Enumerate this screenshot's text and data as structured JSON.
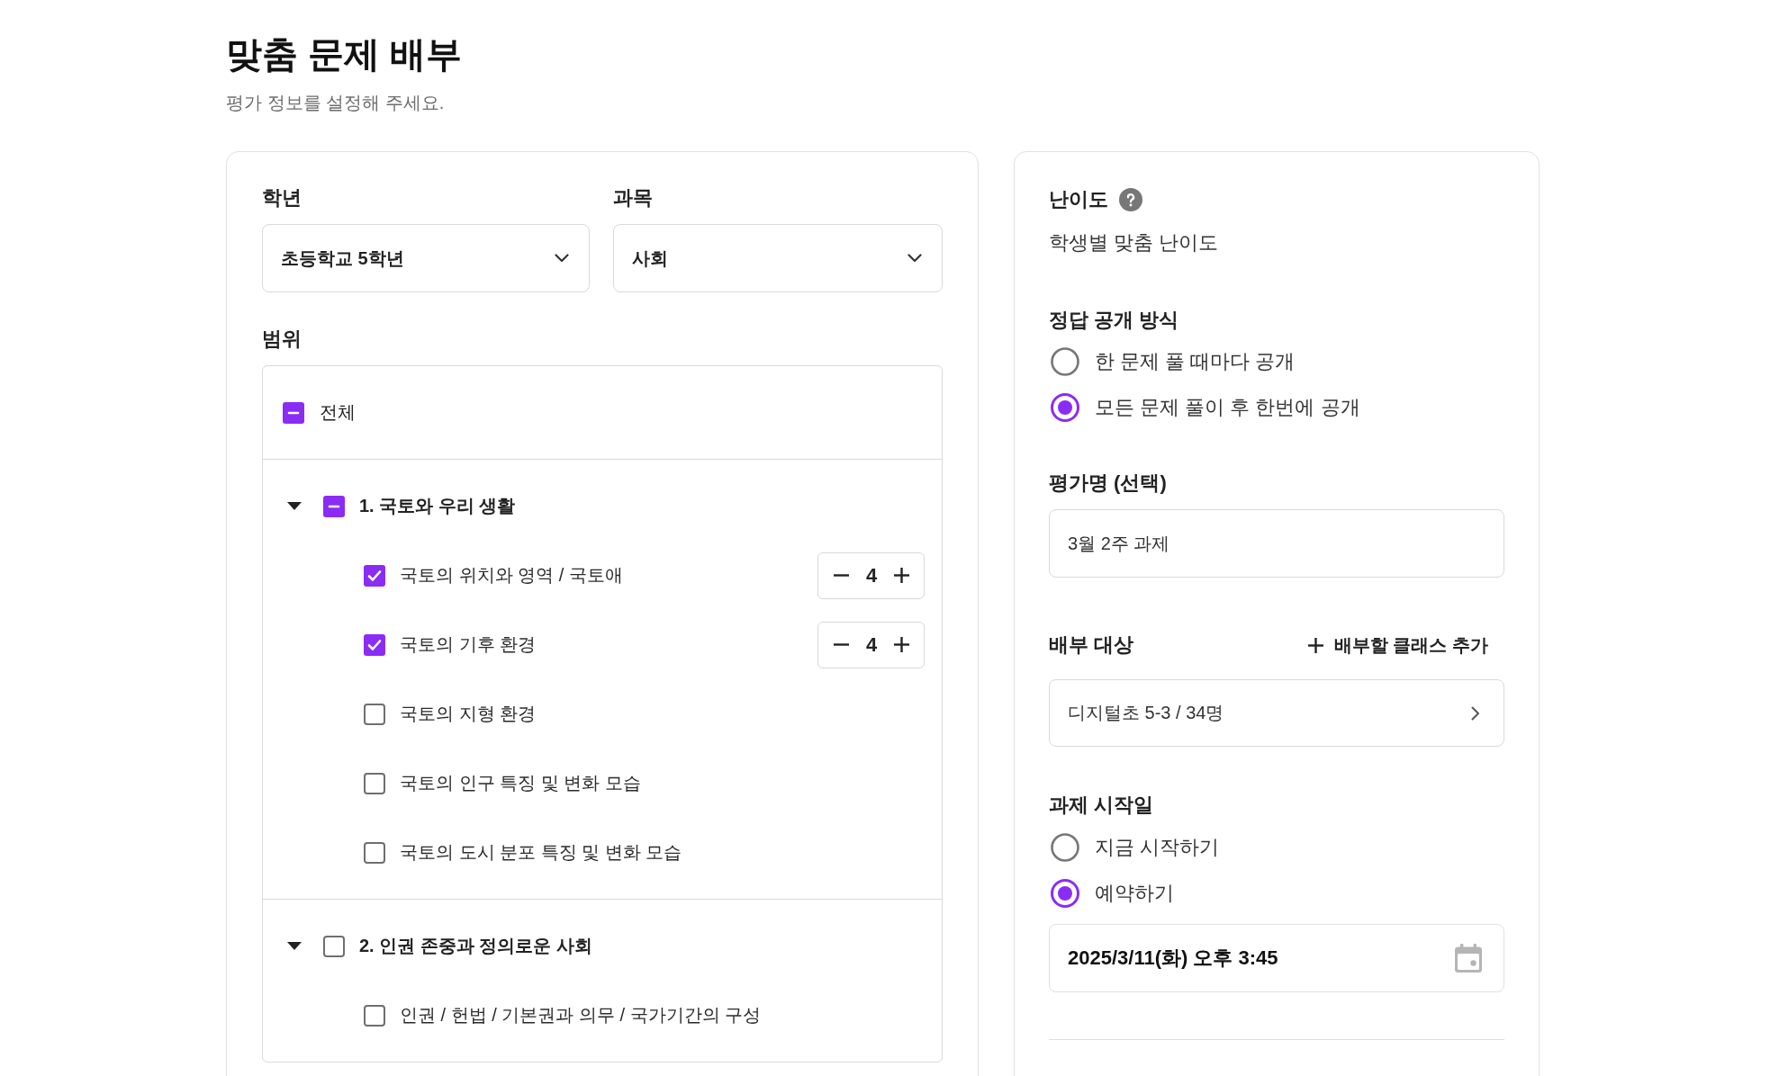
{
  "title": "맞춤 문제 배부",
  "subtitle": "평가 정보를 설정해 주세요.",
  "left_panel": {
    "grade": {
      "label": "학년",
      "value": "초등학교 5학년"
    },
    "subject": {
      "label": "과목",
      "value": "사회"
    },
    "scope": {
      "label": "범위",
      "all": {
        "label": "전체",
        "checked": false,
        "partial": true
      },
      "units": [
        {
          "label": "1. 국토와 우리 생활",
          "expanded": true,
          "checked": false,
          "partial": true,
          "children": [
            {
              "label": "국토의 위치와 영역 / 국토애",
              "checked": true,
              "count": "4"
            },
            {
              "label": "국토의 기후 환경",
              "checked": true,
              "count": "4"
            },
            {
              "label": "국토의 지형 환경",
              "checked": false
            },
            {
              "label": "국토의 인구 특징 및 변화 모습",
              "checked": false
            },
            {
              "label": "국토의 도시 분포 특징 및 변화 모습",
              "checked": false
            }
          ]
        },
        {
          "label": "2. 인권 존중과 정의로운 사회",
          "expanded": true,
          "checked": false,
          "partial": false,
          "children": [
            {
              "label": "인권 / 헌법 / 기본권과 의무 / 국가기간의 구성",
              "checked": false
            }
          ]
        }
      ]
    }
  },
  "right_panel": {
    "difficulty": {
      "label": "난이도",
      "value": "학생별 맞춤 난이도"
    },
    "answer_reveal": {
      "label": "정답 공개 방식",
      "options": [
        {
          "label": "한 문제 풀 때마다 공개",
          "selected": false
        },
        {
          "label": "모든 문제 풀이 후 한번에 공개",
          "selected": true
        }
      ]
    },
    "assessment_name": {
      "label": "평가명 (선택)",
      "value": "3월 2주 과제"
    },
    "recipients": {
      "label": "배부 대상",
      "add_label": "배부할 클래스 추가",
      "value": "디지털초 5-3 / 34명"
    },
    "start_date": {
      "label": "과제 시작일",
      "options": [
        {
          "label": "지금 시작하기",
          "selected": false
        },
        {
          "label": "예약하기",
          "selected": true
        }
      ],
      "value": "2025/3/11(화) 오후 3:45"
    }
  }
}
